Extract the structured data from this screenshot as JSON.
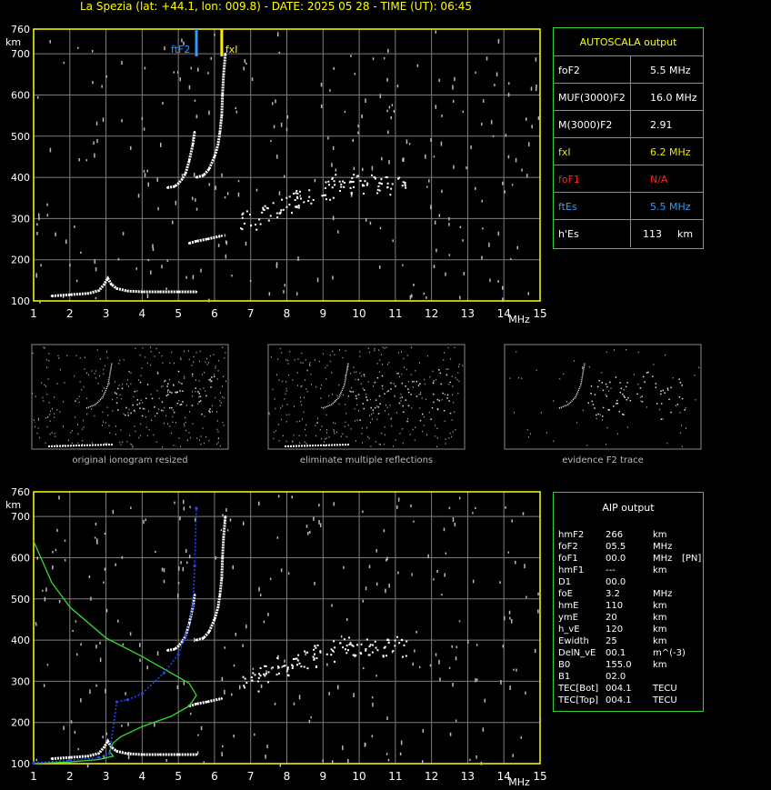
{
  "title": "La Spezia (lat: +44.1, lon: 009.8) - DATE: 2025 05 28 - TIME (UT): 06:45",
  "colors": {
    "frame": "#ffff00",
    "grid": "#7d7d7d",
    "trace": "#ffffff",
    "foF2_marker": "#3399ff",
    "fxI_marker": "#ffee00",
    "profile_green": "#33dd33",
    "profile_blue": "#2244ff",
    "na_red": "#ff2222"
  },
  "autoscala": {
    "header": "AUTOSCALA output",
    "rows": [
      {
        "label": "foF2",
        "value": "5.5 MHz",
        "label_color": "#ffffff",
        "value_color": "#ffffff"
      },
      {
        "label": "MUF(3000)F2",
        "value": "16.0 MHz",
        "label_color": "#ffffff",
        "value_color": "#ffffff"
      },
      {
        "label": "M(3000)F2",
        "value": "2.91",
        "label_color": "#ffffff",
        "value_color": "#ffffff"
      },
      {
        "label": "fxI",
        "value": "6.2 MHz",
        "label_color": "#e6e600",
        "value_color": "#e6e600"
      },
      {
        "label": "foF1",
        "value": "N/A",
        "label_color": "#ff2222",
        "value_color": "#ff2222"
      },
      {
        "label": "ftEs",
        "value": "5.5 MHz",
        "label_color": "#3399ff",
        "value_color": "#3399ff"
      },
      {
        "label": "h'Es",
        "value": "113",
        "unit": "km",
        "label_color": "#ffffff",
        "value_color": "#ffffff"
      }
    ]
  },
  "aip": {
    "header": "AIP output",
    "rows": [
      {
        "k": "hmF2",
        "v": "266",
        "u": "km"
      },
      {
        "k": "foF2",
        "v": "05.5",
        "u": "MHz"
      },
      {
        "k": "foF1",
        "v": "00.0",
        "u": "MHz",
        "x": "[PN]"
      },
      {
        "k": "hmF1",
        "v": "---",
        "u": "km"
      },
      {
        "k": "D1",
        "v": "00.0",
        "u": ""
      },
      {
        "k": "foE",
        "v": "3.2",
        "u": "MHz"
      },
      {
        "k": "hmE",
        "v": "110",
        "u": "km"
      },
      {
        "k": "ymE",
        "v": "20",
        "u": "km"
      },
      {
        "k": "h_vE",
        "v": "120",
        "u": "km"
      },
      {
        "k": "Ewidth",
        "v": "25",
        "u": "km"
      },
      {
        "k": "DelN_vE",
        "v": "00.1",
        "u": "m^(-3)"
      },
      {
        "k": "B0",
        "v": "155.0",
        "u": "km"
      },
      {
        "k": "B1",
        "v": "02.0",
        "u": ""
      },
      {
        "k": "TEC[Bot]",
        "v": "004.1",
        "u": "TECU"
      },
      {
        "k": "TEC[Top]",
        "v": "004.1",
        "u": "TECU"
      }
    ]
  },
  "thumb_captions": [
    "original ionogram resized",
    "eliminate multiple reflections",
    "evidence F2 trace"
  ],
  "chart_data": [
    {
      "type": "scatter",
      "title": "",
      "xlabel": "MHz",
      "ylabel": "km",
      "xlim": [
        1,
        15
      ],
      "ylim": [
        100,
        760
      ],
      "x_ticks": [
        1,
        2,
        3,
        4,
        5,
        6,
        7,
        8,
        9,
        10,
        11,
        12,
        13,
        14,
        15
      ],
      "y_ticks": [
        100,
        200,
        300,
        400,
        500,
        600,
        700,
        760
      ],
      "grid": true,
      "markers": [
        {
          "name": "ftF2",
          "label": "ftF2",
          "x": 5.5,
          "color": "#3399ff"
        },
        {
          "name": "fxI",
          "label": "fxI",
          "x": 6.2,
          "color": "#ffee00"
        }
      ],
      "traces": [
        {
          "name": "Es",
          "points": [
            [
              1.5,
              112
            ],
            [
              2.0,
              115
            ],
            [
              2.5,
              118
            ],
            [
              2.8,
              125
            ],
            [
              2.95,
              140
            ],
            [
              3.05,
              155
            ],
            [
              3.15,
              140
            ],
            [
              3.3,
              130
            ],
            [
              3.6,
              124
            ],
            [
              4.0,
              122
            ],
            [
              4.5,
              122
            ],
            [
              5.0,
              122
            ],
            [
              5.5,
              122
            ]
          ]
        },
        {
          "name": "F2-o",
          "points": [
            [
              4.7,
              375
            ],
            [
              4.9,
              378
            ],
            [
              5.0,
              385
            ],
            [
              5.1,
              395
            ],
            [
              5.2,
              410
            ],
            [
              5.3,
              440
            ],
            [
              5.4,
              480
            ],
            [
              5.45,
              510
            ]
          ]
        },
        {
          "name": "F2-x",
          "points": [
            [
              5.5,
              400
            ],
            [
              5.7,
              405
            ],
            [
              5.85,
              420
            ],
            [
              6.0,
              450
            ],
            [
              6.1,
              480
            ],
            [
              6.15,
              510
            ],
            [
              6.2,
              550
            ],
            [
              6.22,
              600
            ],
            [
              6.25,
              650
            ],
            [
              6.3,
              700
            ]
          ]
        },
        {
          "name": "F-2hop",
          "points": [
            [
              5.3,
              240
            ],
            [
              5.5,
              245
            ],
            [
              5.8,
              250
            ],
            [
              6.2,
              258
            ]
          ]
        },
        {
          "name": "spread",
          "points": [
            [
              7.0,
              300
            ],
            [
              7.5,
              320
            ],
            [
              8.0,
              340
            ],
            [
              8.5,
              350
            ],
            [
              9.0,
              370
            ],
            [
              9.5,
              385
            ],
            [
              10.0,
              385
            ],
            [
              10.5,
              385
            ],
            [
              11.0,
              385
            ]
          ]
        }
      ]
    },
    {
      "type": "line",
      "title": "",
      "xlabel": "MHz",
      "ylabel": "km",
      "xlim": [
        1,
        15
      ],
      "ylim": [
        100,
        760
      ],
      "x_ticks": [
        1,
        2,
        3,
        4,
        5,
        6,
        7,
        8,
        9,
        10,
        11,
        12,
        13,
        14,
        15
      ],
      "y_ticks": [
        100,
        200,
        300,
        400,
        500,
        600,
        700,
        760
      ],
      "grid": true,
      "profile_green": [
        [
          1.0,
          640
        ],
        [
          1.5,
          540
        ],
        [
          2.0,
          480
        ],
        [
          3.0,
          405
        ],
        [
          4.0,
          360
        ],
        [
          4.8,
          320
        ],
        [
          5.3,
          295
        ],
        [
          5.5,
          266
        ],
        [
          5.3,
          240
        ],
        [
          4.8,
          215
        ],
        [
          4.0,
          190
        ],
        [
          3.4,
          165
        ],
        [
          3.2,
          150
        ],
        [
          3.1,
          130
        ],
        [
          3.2,
          118
        ],
        [
          2.8,
          110
        ],
        [
          2.0,
          104
        ],
        [
          1.0,
          100
        ]
      ],
      "profile_blue": [
        [
          1.0,
          102
        ],
        [
          2.0,
          108
        ],
        [
          2.8,
          115
        ],
        [
          3.1,
          125
        ],
        [
          3.3,
          250
        ],
        [
          3.6,
          255
        ],
        [
          4.0,
          270
        ],
        [
          4.6,
          320
        ],
        [
          5.0,
          365
        ],
        [
          5.2,
          410
        ],
        [
          5.4,
          480
        ],
        [
          5.45,
          580
        ],
        [
          5.5,
          720
        ]
      ],
      "traces": [
        {
          "name": "Es",
          "points": [
            [
              1.5,
              112
            ],
            [
              2.0,
              115
            ],
            [
              2.5,
              118
            ],
            [
              2.8,
              125
            ],
            [
              2.95,
              140
            ],
            [
              3.05,
              155
            ],
            [
              3.15,
              140
            ],
            [
              3.3,
              130
            ],
            [
              3.6,
              124
            ],
            [
              4.0,
              122
            ],
            [
              4.5,
              122
            ],
            [
              5.0,
              122
            ],
            [
              5.5,
              122
            ]
          ]
        },
        {
          "name": "F2-o",
          "points": [
            [
              4.7,
              375
            ],
            [
              4.9,
              378
            ],
            [
              5.0,
              385
            ],
            [
              5.1,
              395
            ],
            [
              5.2,
              410
            ],
            [
              5.3,
              440
            ],
            [
              5.4,
              480
            ],
            [
              5.45,
              510
            ]
          ]
        },
        {
          "name": "F2-x",
          "points": [
            [
              5.5,
              400
            ],
            [
              5.7,
              405
            ],
            [
              5.85,
              420
            ],
            [
              6.0,
              450
            ],
            [
              6.1,
              480
            ],
            [
              6.15,
              510
            ],
            [
              6.2,
              550
            ],
            [
              6.22,
              600
            ],
            [
              6.25,
              650
            ],
            [
              6.3,
              700
            ]
          ]
        },
        {
          "name": "F-2hop",
          "points": [
            [
              5.3,
              240
            ],
            [
              5.5,
              245
            ],
            [
              5.8,
              250
            ],
            [
              6.2,
              258
            ]
          ]
        },
        {
          "name": "spread",
          "points": [
            [
              7.0,
              300
            ],
            [
              7.5,
              320
            ],
            [
              8.0,
              340
            ],
            [
              8.5,
              350
            ],
            [
              9.0,
              370
            ],
            [
              9.5,
              385
            ],
            [
              10.0,
              385
            ],
            [
              10.5,
              385
            ],
            [
              11.0,
              385
            ]
          ]
        }
      ]
    }
  ]
}
